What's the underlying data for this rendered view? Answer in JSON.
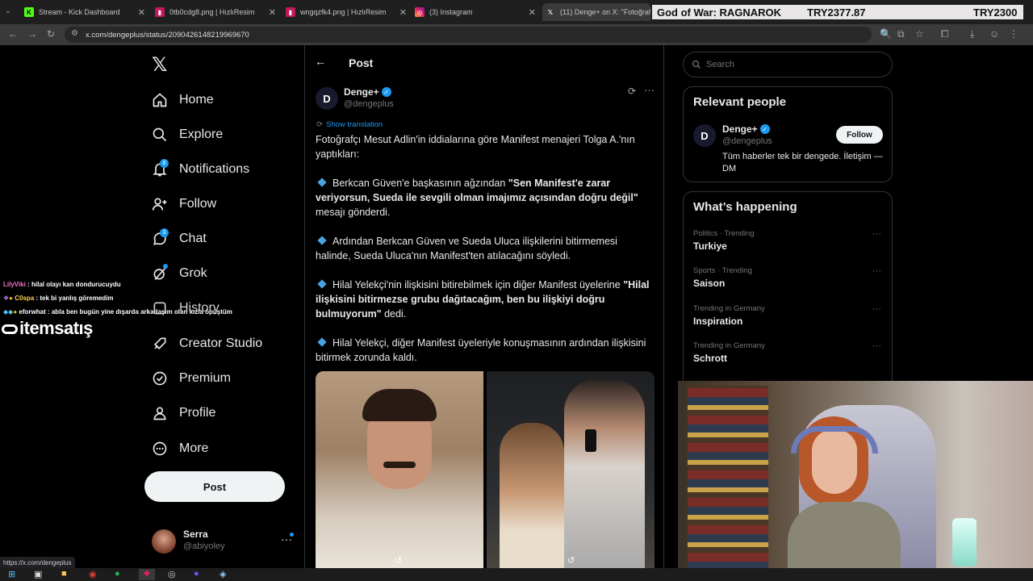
{
  "tabs": [
    {
      "title": "Stream - Kick Dashboard"
    },
    {
      "title": "0tb0cdg8.png | HızlıResim"
    },
    {
      "title": "wngqzfk4.png | HızlıResim"
    },
    {
      "title": "(3) Instagram"
    },
    {
      "title": "(11) Denge+ on X: \"Fotoğrafç"
    }
  ],
  "game_banner": {
    "title": "God of War: RAGNAROK",
    "price1": "TRY2377.87",
    "price2": "TRY2300"
  },
  "address": {
    "url": "x.com/dengeplus/status/2090426148219969670"
  },
  "nav": {
    "items": [
      "Home",
      "Explore",
      "Notifications",
      "Follow",
      "Chat",
      "Grok",
      "History",
      "Creator Studio",
      "Premium",
      "Profile",
      "More"
    ],
    "notif_badge": "8",
    "chat_badge": "3",
    "post_label": "Post",
    "account": {
      "name": "Serra",
      "handle": "@abiyoley"
    }
  },
  "post": {
    "header": "Post",
    "author": {
      "name": "Denge+",
      "handle": "@dengeplus"
    },
    "show_translation": "Show translation",
    "intro": "Fotoğrafçı Mesut Adlin'in iddialarına göre Manifest menajeri Tolga A.'nın yaptıkları:",
    "b1_pre": "Berkcan Güven'e başkasının ağzından ",
    "b1_bold": "\"Sen Manifest'e zarar veriyorsun, Sueda ile sevgili olman imajımız açısından doğru değil\"",
    "b1_post": " mesajı gönderdi.",
    "b2": "Ardından Berkcan Güven ve Sueda Uluca ilişkilerini bitirmemesi halinde, Sueda Uluca'nın Manifest'ten atılacağını söyledi.",
    "b3_pre": "Hilal Yelekçi'nin ilişkisini bitirebilmek için diğer Manifest üyelerine ",
    "b3_bold": "\"Hilal ilişkisini bitirmezse grubu dağıtacağım, ben bu ilişkiyi doğru bulmuyorum\"",
    "b3_post": " dedi.",
    "b4": "Hilal Yelekçi, diğer Manifest üyeleriyle konuşmasının ardından ilişkisini bitirmek zorunda kaldı."
  },
  "search": {
    "placeholder": "Search"
  },
  "relevant": {
    "title": "Relevant people",
    "name": "Denge+",
    "handle": "@dengeplus",
    "bio": "Tüm haberler tek bir dengede. İletişim — DM",
    "follow": "Follow"
  },
  "happening": {
    "title": "What’s happening",
    "trends": [
      {
        "meta": "Politics · Trending",
        "name": "Turkiye"
      },
      {
        "meta": "Sports · Trending",
        "name": "Saison"
      },
      {
        "meta": "Trending in Germany",
        "name": "Inspiration"
      },
      {
        "meta": "Trending in Germany",
        "name": "Schrott"
      }
    ]
  },
  "chat_overlay": [
    {
      "user": "LilyViki",
      "msg": ": hilal olayı kan dondurucuydu"
    },
    {
      "user": "C0spa",
      "msg": ": tek bi yanlış göremedim"
    },
    {
      "user": "eforwhat",
      "msg": ": abla ben bugün yine dışarda arkadaşım olan kızla öpüştüm"
    }
  ],
  "sponsor": "itemsatış",
  "status_url": "https://x.com/dengeplus",
  "colors": {
    "accent": "#1d9bf0",
    "bg": "#000000",
    "border": "#2f3336"
  }
}
